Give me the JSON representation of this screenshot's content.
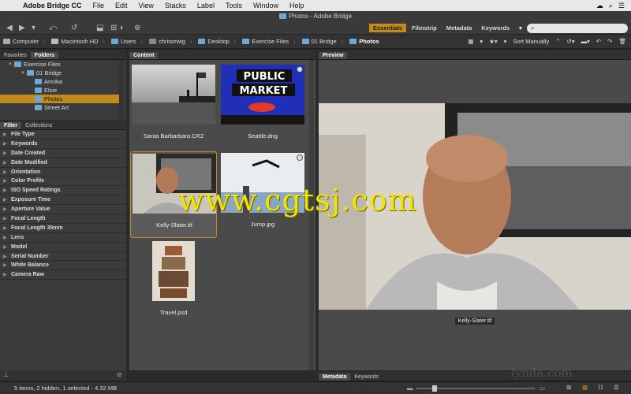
{
  "menubar": {
    "items": [
      "Adobe Bridge CC",
      "File",
      "Edit",
      "View",
      "Stacks",
      "Label",
      "Tools",
      "Window",
      "Help"
    ]
  },
  "window": {
    "title": "Photos - Adobe Bridge"
  },
  "workspaces": [
    "Essentials",
    "Filmstrip",
    "Metadata",
    "Keywords"
  ],
  "search": {
    "placeholder": ""
  },
  "path": [
    "Computer",
    "Macintosh HD",
    "Users",
    "chrisorwig",
    "Desktop",
    "Exercise Files",
    "01 Bridge",
    "Photos"
  ],
  "sort": {
    "label": "Sort Manually"
  },
  "left_top_tabs": [
    "Favorites",
    "Folders"
  ],
  "folders": [
    {
      "label": "Exercise Files",
      "depth": 1
    },
    {
      "label": "01 Bridge",
      "depth": 2
    },
    {
      "label": "Annika",
      "depth": 3
    },
    {
      "label": "Elsie",
      "depth": 3
    },
    {
      "label": "Photos",
      "depth": 3
    },
    {
      "label": "Street Art",
      "depth": 3
    }
  ],
  "left_bottom_tabs": [
    "Filter",
    "Collections"
  ],
  "filters": [
    "File Type",
    "Keywords",
    "Date Created",
    "Date Modified",
    "Orientation",
    "Color Profile",
    "ISO Speed Ratings",
    "Exposure Time",
    "Aperture Value",
    "Focal Length",
    "Focal Length 35mm",
    "Lens",
    "Model",
    "Serial Number",
    "White Balance",
    "Camera Raw"
  ],
  "content": {
    "tab": "Content",
    "files": [
      {
        "name": "Santa Barbarbara.CR2"
      },
      {
        "name": "Seattle.dng"
      },
      {
        "name": "Kelly-Slater.tif"
      },
      {
        "name": "Jump.jpg"
      },
      {
        "name": "Travel.psd"
      }
    ],
    "seattle_sign": [
      "PUBLIC",
      "MARKET"
    ]
  },
  "preview": {
    "tab": "Preview",
    "caption": "Kelly-Slater.tif"
  },
  "bottom_tabs": [
    "Metadata",
    "Keywords"
  ],
  "status": "5 items, 2 hidden, 1 selected - 4.32 MB",
  "watermark": "www.cgtsj.com",
  "lynda": "lynda.com",
  "colors": {
    "accent": "#c08b1c",
    "folder": "#6aa9d8",
    "watermark": "#f3e400"
  }
}
